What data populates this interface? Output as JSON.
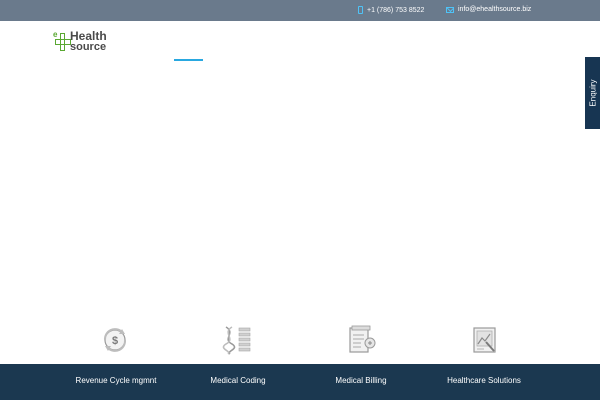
{
  "topbar": {
    "phone": "+1 (786) 753 8522",
    "email": "info@ehealthsource.biz"
  },
  "logo": {
    "letter": "e",
    "word1": "Health",
    "word2": "source"
  },
  "enquiry": {
    "label": "Enquiry"
  },
  "services": [
    {
      "label": "Revenue Cycle mgmnt",
      "icon": "dollar-cycle-icon"
    },
    {
      "label": "Medical Coding",
      "icon": "dna-icon"
    },
    {
      "label": "Medical Billing",
      "icon": "billing-document-icon"
    },
    {
      "label": "Healthcare Solutions",
      "icon": "healthcare-chart-icon"
    }
  ],
  "colors": {
    "topbar": "#6a7a8c",
    "accent": "#29a8e0",
    "brand_green": "#5aa832",
    "bottom_bar": "#1b3850",
    "enquiry_tab": "#173552"
  }
}
